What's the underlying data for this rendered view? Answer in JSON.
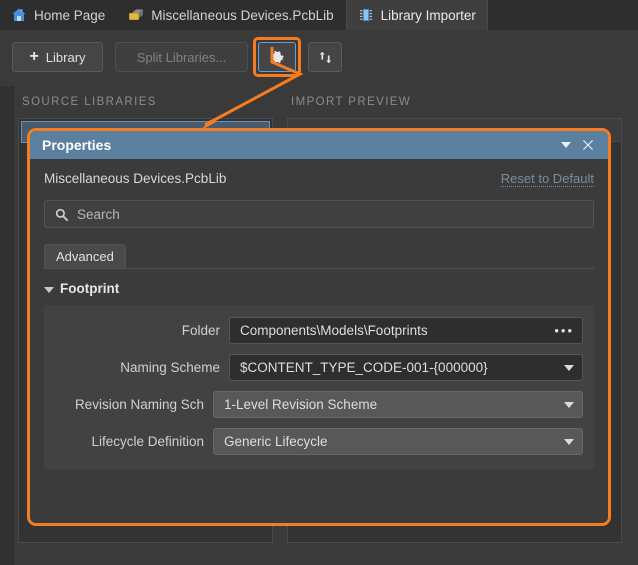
{
  "tabs": [
    {
      "label": "Home Page",
      "icon": "home-icon",
      "active": false
    },
    {
      "label": "Miscellaneous Devices.PcbLib",
      "icon": "pcb-library-icon",
      "active": false
    },
    {
      "label": "Library Importer",
      "icon": "ic-chip-icon",
      "active": true
    }
  ],
  "toolbar": {
    "library_label": "Library",
    "split_label": "Split Libraries...",
    "gear_icon": "gear-icon",
    "sync_icon": "swap-arrows-icon"
  },
  "sections": {
    "source_libraries": "SOURCE LIBRARIES",
    "import_preview": "IMPORT PREVIEW"
  },
  "dialog": {
    "title": "Properties",
    "collapse_icon": "chevron-down-icon",
    "close_icon": "close-icon",
    "subtitle": "Miscellaneous Devices.PcbLib",
    "reset_label": "Reset to Default",
    "search": {
      "placeholder": "Search",
      "value": "",
      "icon": "search-icon"
    },
    "tab": "Advanced",
    "group": {
      "title": "Footprint",
      "expanded": true,
      "fields": [
        {
          "label": "Folder",
          "value": "Components\\Models\\Footprints",
          "control": "path",
          "style": "dark",
          "trailing": "ellipsis-button"
        },
        {
          "label": "Naming Scheme",
          "value": "$CONTENT_TYPE_CODE-001-{000000}",
          "control": "dropdown",
          "style": "dark",
          "trailing": "chevron-down-icon"
        },
        {
          "label": "Revision Naming Sch",
          "value": "1-Level Revision Scheme",
          "control": "dropdown",
          "style": "light",
          "trailing": "chevron-down-icon"
        },
        {
          "label": "Lifecycle Definition",
          "value": "Generic Lifecycle",
          "control": "dropdown",
          "style": "light",
          "trailing": "chevron-down-icon"
        }
      ]
    }
  },
  "annotation": {
    "highlight_color": "#f57c20",
    "focus_color": "#6c9fd0",
    "titlebar_color": "#5b7f9e"
  }
}
